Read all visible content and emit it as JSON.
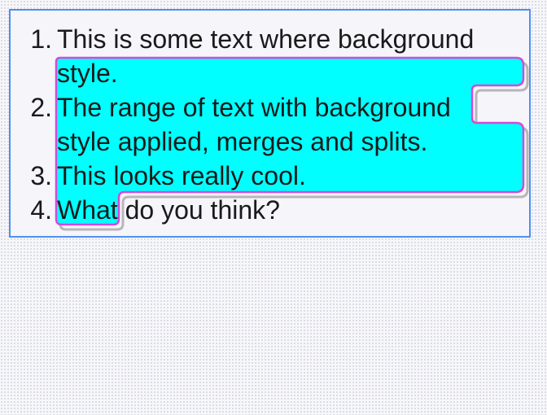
{
  "list": {
    "items": [
      {
        "number": "1.",
        "lines": [
          "This is some text where background",
          "style."
        ]
      },
      {
        "number": "2.",
        "lines": [
          "The range of text with background",
          "style applied, merges and splits."
        ]
      },
      {
        "number": "3.",
        "lines": [
          "This looks really cool."
        ]
      },
      {
        "number": "4.",
        "parts": [
          "What",
          " do you think?"
        ]
      }
    ]
  },
  "colors": {
    "highlight_fill": "#00ffff",
    "highlight_outline": "#d24bd8",
    "editor_border": "#4f8ff0"
  }
}
